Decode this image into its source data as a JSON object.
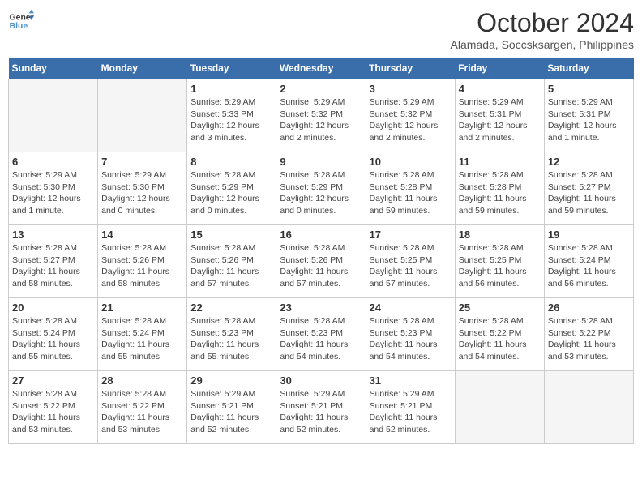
{
  "logo": {
    "line1": "General",
    "line2": "Blue"
  },
  "title": "October 2024",
  "location": "Alamada, Soccsksargen, Philippines",
  "days_header": [
    "Sunday",
    "Monday",
    "Tuesday",
    "Wednesday",
    "Thursday",
    "Friday",
    "Saturday"
  ],
  "weeks": [
    [
      {
        "day": "",
        "info": ""
      },
      {
        "day": "",
        "info": ""
      },
      {
        "day": "1",
        "info": "Sunrise: 5:29 AM\nSunset: 5:33 PM\nDaylight: 12 hours\nand 3 minutes."
      },
      {
        "day": "2",
        "info": "Sunrise: 5:29 AM\nSunset: 5:32 PM\nDaylight: 12 hours\nand 2 minutes."
      },
      {
        "day": "3",
        "info": "Sunrise: 5:29 AM\nSunset: 5:32 PM\nDaylight: 12 hours\nand 2 minutes."
      },
      {
        "day": "4",
        "info": "Sunrise: 5:29 AM\nSunset: 5:31 PM\nDaylight: 12 hours\nand 2 minutes."
      },
      {
        "day": "5",
        "info": "Sunrise: 5:29 AM\nSunset: 5:31 PM\nDaylight: 12 hours\nand 1 minute."
      }
    ],
    [
      {
        "day": "6",
        "info": "Sunrise: 5:29 AM\nSunset: 5:30 PM\nDaylight: 12 hours\nand 1 minute."
      },
      {
        "day": "7",
        "info": "Sunrise: 5:29 AM\nSunset: 5:30 PM\nDaylight: 12 hours\nand 0 minutes."
      },
      {
        "day": "8",
        "info": "Sunrise: 5:28 AM\nSunset: 5:29 PM\nDaylight: 12 hours\nand 0 minutes."
      },
      {
        "day": "9",
        "info": "Sunrise: 5:28 AM\nSunset: 5:29 PM\nDaylight: 12 hours\nand 0 minutes."
      },
      {
        "day": "10",
        "info": "Sunrise: 5:28 AM\nSunset: 5:28 PM\nDaylight: 11 hours\nand 59 minutes."
      },
      {
        "day": "11",
        "info": "Sunrise: 5:28 AM\nSunset: 5:28 PM\nDaylight: 11 hours\nand 59 minutes."
      },
      {
        "day": "12",
        "info": "Sunrise: 5:28 AM\nSunset: 5:27 PM\nDaylight: 11 hours\nand 59 minutes."
      }
    ],
    [
      {
        "day": "13",
        "info": "Sunrise: 5:28 AM\nSunset: 5:27 PM\nDaylight: 11 hours\nand 58 minutes."
      },
      {
        "day": "14",
        "info": "Sunrise: 5:28 AM\nSunset: 5:26 PM\nDaylight: 11 hours\nand 58 minutes."
      },
      {
        "day": "15",
        "info": "Sunrise: 5:28 AM\nSunset: 5:26 PM\nDaylight: 11 hours\nand 57 minutes."
      },
      {
        "day": "16",
        "info": "Sunrise: 5:28 AM\nSunset: 5:26 PM\nDaylight: 11 hours\nand 57 minutes."
      },
      {
        "day": "17",
        "info": "Sunrise: 5:28 AM\nSunset: 5:25 PM\nDaylight: 11 hours\nand 57 minutes."
      },
      {
        "day": "18",
        "info": "Sunrise: 5:28 AM\nSunset: 5:25 PM\nDaylight: 11 hours\nand 56 minutes."
      },
      {
        "day": "19",
        "info": "Sunrise: 5:28 AM\nSunset: 5:24 PM\nDaylight: 11 hours\nand 56 minutes."
      }
    ],
    [
      {
        "day": "20",
        "info": "Sunrise: 5:28 AM\nSunset: 5:24 PM\nDaylight: 11 hours\nand 55 minutes."
      },
      {
        "day": "21",
        "info": "Sunrise: 5:28 AM\nSunset: 5:24 PM\nDaylight: 11 hours\nand 55 minutes."
      },
      {
        "day": "22",
        "info": "Sunrise: 5:28 AM\nSunset: 5:23 PM\nDaylight: 11 hours\nand 55 minutes."
      },
      {
        "day": "23",
        "info": "Sunrise: 5:28 AM\nSunset: 5:23 PM\nDaylight: 11 hours\nand 54 minutes."
      },
      {
        "day": "24",
        "info": "Sunrise: 5:28 AM\nSunset: 5:23 PM\nDaylight: 11 hours\nand 54 minutes."
      },
      {
        "day": "25",
        "info": "Sunrise: 5:28 AM\nSunset: 5:22 PM\nDaylight: 11 hours\nand 54 minutes."
      },
      {
        "day": "26",
        "info": "Sunrise: 5:28 AM\nSunset: 5:22 PM\nDaylight: 11 hours\nand 53 minutes."
      }
    ],
    [
      {
        "day": "27",
        "info": "Sunrise: 5:28 AM\nSunset: 5:22 PM\nDaylight: 11 hours\nand 53 minutes."
      },
      {
        "day": "28",
        "info": "Sunrise: 5:28 AM\nSunset: 5:22 PM\nDaylight: 11 hours\nand 53 minutes."
      },
      {
        "day": "29",
        "info": "Sunrise: 5:29 AM\nSunset: 5:21 PM\nDaylight: 11 hours\nand 52 minutes."
      },
      {
        "day": "30",
        "info": "Sunrise: 5:29 AM\nSunset: 5:21 PM\nDaylight: 11 hours\nand 52 minutes."
      },
      {
        "day": "31",
        "info": "Sunrise: 5:29 AM\nSunset: 5:21 PM\nDaylight: 11 hours\nand 52 minutes."
      },
      {
        "day": "",
        "info": ""
      },
      {
        "day": "",
        "info": ""
      }
    ]
  ]
}
